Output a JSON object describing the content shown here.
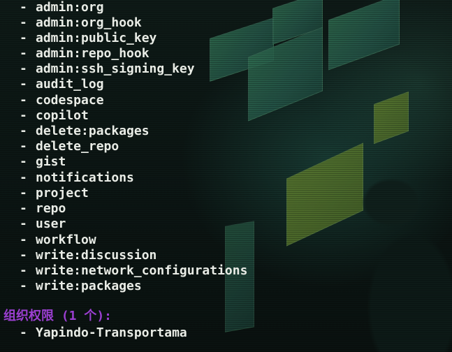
{
  "terminal": {
    "scopes": [
      "admin:org",
      "admin:org_hook",
      "admin:public_key",
      "admin:repo_hook",
      "admin:ssh_signing_key",
      "audit_log",
      "codespace",
      "copilot",
      "delete:packages",
      "delete_repo",
      "gist",
      "notifications",
      "project",
      "repo",
      "user",
      "workflow",
      "write:discussion",
      "write:network_configurations",
      "write:packages"
    ],
    "bullet": "-",
    "org_section_title": "组织权限 (1 个):",
    "orgs": [
      "Yapindo-Transportama"
    ],
    "colors": {
      "text": "#e9ece6",
      "section_heading": "#9b3fd1"
    }
  }
}
